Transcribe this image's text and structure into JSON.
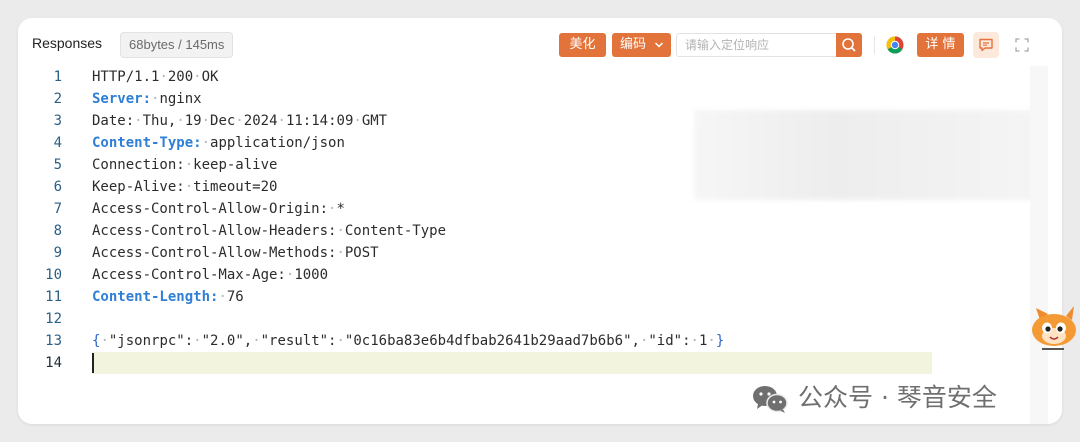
{
  "toolbar": {
    "title": "Responses",
    "stats": "68bytes / 145ms",
    "beautify_label": "美化",
    "encoding_label": "编码",
    "search_placeholder": "请输入定位响应",
    "details_label": "详 情"
  },
  "editor": {
    "lines": [
      {
        "num": "1",
        "parts": [
          {
            "t": "HTTP/1.1",
            "c": ""
          },
          {
            "t": "·",
            "c": "dot"
          },
          {
            "t": "200",
            "c": ""
          },
          {
            "t": "·",
            "c": "dot"
          },
          {
            "t": "OK",
            "c": ""
          }
        ]
      },
      {
        "num": "2",
        "parts": [
          {
            "t": "Server:",
            "c": "key"
          },
          {
            "t": "·",
            "c": "dot"
          },
          {
            "t": "nginx",
            "c": ""
          }
        ]
      },
      {
        "num": "3",
        "parts": [
          {
            "t": "Date:",
            "c": ""
          },
          {
            "t": "·",
            "c": "dot"
          },
          {
            "t": "Thu,",
            "c": ""
          },
          {
            "t": "·",
            "c": "dot"
          },
          {
            "t": "19",
            "c": ""
          },
          {
            "t": "·",
            "c": "dot"
          },
          {
            "t": "Dec",
            "c": ""
          },
          {
            "t": "·",
            "c": "dot"
          },
          {
            "t": "2024",
            "c": ""
          },
          {
            "t": "·",
            "c": "dot"
          },
          {
            "t": "11:14:09",
            "c": ""
          },
          {
            "t": "·",
            "c": "dot"
          },
          {
            "t": "GMT",
            "c": ""
          }
        ]
      },
      {
        "num": "4",
        "parts": [
          {
            "t": "Content-Type:",
            "c": "key"
          },
          {
            "t": "·",
            "c": "dot"
          },
          {
            "t": "application/json",
            "c": ""
          }
        ]
      },
      {
        "num": "5",
        "parts": [
          {
            "t": "Connection:",
            "c": ""
          },
          {
            "t": "·",
            "c": "dot"
          },
          {
            "t": "keep-alive",
            "c": ""
          }
        ]
      },
      {
        "num": "6",
        "parts": [
          {
            "t": "Keep-Alive:",
            "c": ""
          },
          {
            "t": "·",
            "c": "dot"
          },
          {
            "t": "timeout=20",
            "c": ""
          }
        ]
      },
      {
        "num": "7",
        "parts": [
          {
            "t": "Access-Control-Allow-Origin:",
            "c": ""
          },
          {
            "t": "·",
            "c": "dot"
          },
          {
            "t": "*",
            "c": ""
          }
        ]
      },
      {
        "num": "8",
        "parts": [
          {
            "t": "Access-Control-Allow-Headers:",
            "c": ""
          },
          {
            "t": "·",
            "c": "dot"
          },
          {
            "t": "Content-Type",
            "c": ""
          }
        ]
      },
      {
        "num": "9",
        "parts": [
          {
            "t": "Access-Control-Allow-Methods:",
            "c": ""
          },
          {
            "t": "·",
            "c": "dot"
          },
          {
            "t": "POST",
            "c": ""
          }
        ]
      },
      {
        "num": "10",
        "parts": [
          {
            "t": "Access-Control-Max-Age:",
            "c": ""
          },
          {
            "t": "·",
            "c": "dot"
          },
          {
            "t": "1000",
            "c": ""
          }
        ]
      },
      {
        "num": "11",
        "parts": [
          {
            "t": "Content-Length:",
            "c": "key"
          },
          {
            "t": "·",
            "c": "dot"
          },
          {
            "t": "76",
            "c": ""
          }
        ]
      },
      {
        "num": "12",
        "parts": []
      },
      {
        "num": "13",
        "parts": [
          {
            "t": "{",
            "c": "brace"
          },
          {
            "t": "·",
            "c": "dot"
          },
          {
            "t": "\"jsonrpc\":",
            "c": ""
          },
          {
            "t": "·",
            "c": "dot"
          },
          {
            "t": "\"2.0\",",
            "c": ""
          },
          {
            "t": "·",
            "c": "dot"
          },
          {
            "t": "\"result\":",
            "c": ""
          },
          {
            "t": "·",
            "c": "dot"
          },
          {
            "t": "\"0c16ba83e6b4dfbab2641b29aad7b6b6\",",
            "c": ""
          },
          {
            "t": "·",
            "c": "dot"
          },
          {
            "t": "\"id\":",
            "c": ""
          },
          {
            "t": "·",
            "c": "dot"
          },
          {
            "t": "1",
            "c": ""
          },
          {
            "t": "·",
            "c": "dot"
          },
          {
            "t": "}",
            "c": "brace"
          }
        ]
      },
      {
        "num": "14",
        "parts": [],
        "current": true
      }
    ]
  },
  "watermark": {
    "text": "公众号 · 琴音安全"
  },
  "colors": {
    "accent": "#e2733a",
    "key": "#2f7fd6",
    "line_number": "#2b5f85",
    "current_line_bg": "#f2f4de"
  },
  "icons": [
    "chevron-down-icon",
    "search-icon",
    "chrome-icon",
    "comment-icon",
    "fullscreen-icon",
    "wechat-icon",
    "mascot-icon"
  ]
}
